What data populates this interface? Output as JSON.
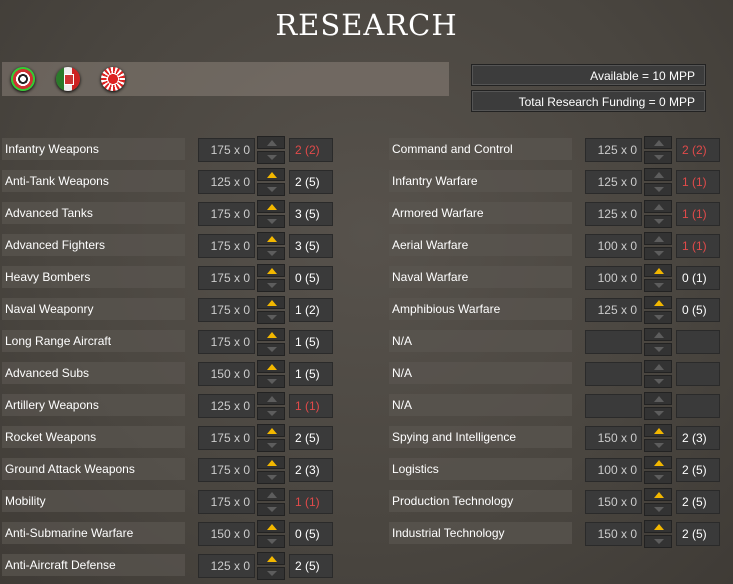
{
  "title": "RESEARCH",
  "flags": [
    "german-flag-icon",
    "italian-flag-icon",
    "japanese-flag-icon"
  ],
  "available": "Available =  10 MPP",
  "total_funding": "Total Research Funding =  0 MPP",
  "left": [
    {
      "name": "Infantry Weapons",
      "cost": "175 x 0",
      "level": "2 (2)",
      "maxed": true,
      "up": false
    },
    {
      "name": "Anti-Tank Weapons",
      "cost": "125 x 0",
      "level": "2 (5)",
      "maxed": false,
      "up": true
    },
    {
      "name": "Advanced Tanks",
      "cost": "175 x 0",
      "level": "3 (5)",
      "maxed": false,
      "up": true
    },
    {
      "name": "Advanced Fighters",
      "cost": "175 x 0",
      "level": "3 (5)",
      "maxed": false,
      "up": true
    },
    {
      "name": "Heavy Bombers",
      "cost": "175 x 0",
      "level": "0 (5)",
      "maxed": false,
      "up": true
    },
    {
      "name": "Naval Weaponry",
      "cost": "175 x 0",
      "level": "1 (2)",
      "maxed": false,
      "up": true
    },
    {
      "name": "Long Range Aircraft",
      "cost": "175 x 0",
      "level": "1 (5)",
      "maxed": false,
      "up": true
    },
    {
      "name": "Advanced Subs",
      "cost": "150 x 0",
      "level": "1 (5)",
      "maxed": false,
      "up": true
    },
    {
      "name": "Artillery Weapons",
      "cost": "125 x 0",
      "level": "1 (1)",
      "maxed": true,
      "up": false
    },
    {
      "name": "Rocket Weapons",
      "cost": "175 x 0",
      "level": "2 (5)",
      "maxed": false,
      "up": true
    },
    {
      "name": "Ground Attack Weapons",
      "cost": "175 x 0",
      "level": "2 (3)",
      "maxed": false,
      "up": true
    },
    {
      "name": "Mobility",
      "cost": "175 x 0",
      "level": "1 (1)",
      "maxed": true,
      "up": false
    },
    {
      "name": "Anti-Submarine Warfare",
      "cost": "150 x 0",
      "level": "0 (5)",
      "maxed": false,
      "up": true
    },
    {
      "name": "Anti-Aircraft Defense",
      "cost": "125 x 0",
      "level": "2 (5)",
      "maxed": false,
      "up": true
    }
  ],
  "right": [
    {
      "name": "Command and Control",
      "cost": "125 x 0",
      "level": "2 (2)",
      "maxed": true,
      "up": false
    },
    {
      "name": "Infantry Warfare",
      "cost": "125 x 0",
      "level": "1 (1)",
      "maxed": true,
      "up": false
    },
    {
      "name": "Armored Warfare",
      "cost": "125 x 0",
      "level": "1 (1)",
      "maxed": true,
      "up": false
    },
    {
      "name": "Aerial Warfare",
      "cost": "100 x 0",
      "level": "1 (1)",
      "maxed": true,
      "up": false
    },
    {
      "name": "Naval Warfare",
      "cost": "100 x 0",
      "level": "0 (1)",
      "maxed": false,
      "up": true
    },
    {
      "name": "Amphibious Warfare",
      "cost": "125 x 0",
      "level": "0 (5)",
      "maxed": false,
      "up": true
    },
    {
      "name": "N/A",
      "cost": "",
      "level": "",
      "maxed": false,
      "up": false
    },
    {
      "name": "N/A",
      "cost": "",
      "level": "",
      "maxed": false,
      "up": false
    },
    {
      "name": "N/A",
      "cost": "",
      "level": "",
      "maxed": false,
      "up": false
    },
    {
      "name": "Spying and Intelligence",
      "cost": "150 x 0",
      "level": "2 (3)",
      "maxed": false,
      "up": true
    },
    {
      "name": "Logistics",
      "cost": "100 x 0",
      "level": "2 (5)",
      "maxed": false,
      "up": true
    },
    {
      "name": "Production Technology",
      "cost": "150 x 0",
      "level": "2 (5)",
      "maxed": false,
      "up": true
    },
    {
      "name": "Industrial Technology",
      "cost": "150 x 0",
      "level": "2 (5)",
      "maxed": false,
      "up": true
    }
  ]
}
